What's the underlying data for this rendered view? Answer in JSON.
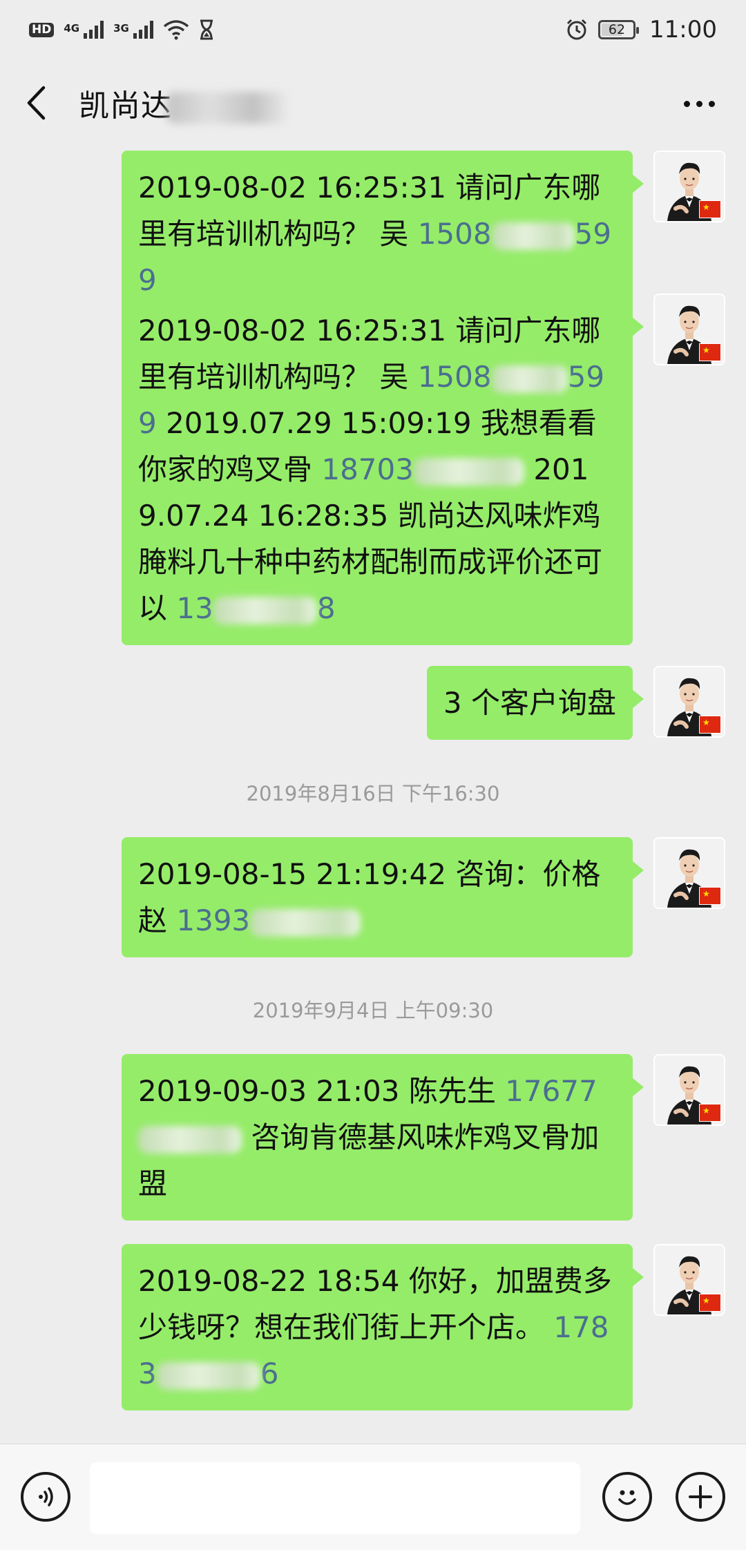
{
  "status_bar": {
    "hd": "HD",
    "net_1": "4G",
    "net_2": "3G",
    "battery": "62",
    "time": "11:00"
  },
  "header": {
    "title": "凯尚达"
  },
  "messages": [
    {
      "parts": [
        {
          "t": "text",
          "v": "2019-08-02 16:25:31  请问广东哪里有培训机构吗？    吴 "
        },
        {
          "t": "phone",
          "v": "1508"
        },
        {
          "t": "redact",
          "w": 120
        },
        {
          "t": "phone",
          "v": "599"
        }
      ]
    },
    {
      "parts": [
        {
          "t": "text",
          "v": "2019-08-02 16:25:31  请问广东哪里有培训机构吗？    吴 "
        },
        {
          "t": "phone",
          "v": "1508"
        },
        {
          "t": "redact",
          "w": 110
        },
        {
          "t": "phone",
          "v": "599"
        },
        {
          "t": "text",
          "v": " 2019.07.29 15:09:19 我想看看你家的鸡叉骨 "
        },
        {
          "t": "phone",
          "v": "18703"
        },
        {
          "t": "redact",
          "w": 160
        },
        {
          "t": "text",
          "v": " 2019.07.24 16:28:35 凯尚达风味炸鸡腌料几十种中药材配制而成评价还可以 "
        },
        {
          "t": "phone",
          "v": "13"
        },
        {
          "t": "redact",
          "w": 150
        },
        {
          "t": "phone",
          "v": "8"
        }
      ]
    },
    {
      "parts": [
        {
          "t": "text",
          "v": "3 个客户询盘"
        }
      ]
    },
    {
      "parts": [
        {
          "t": "text",
          "v": "2019-08-15 21:19:42 咨询：价格赵 "
        },
        {
          "t": "phone",
          "v": "1393"
        },
        {
          "t": "redact",
          "w": 160
        }
      ]
    },
    {
      "parts": [
        {
          "t": "text",
          "v": "2019-09-03 21:03  陈先生 "
        },
        {
          "t": "phone",
          "v": "17677"
        },
        {
          "t": "redact",
          "w": 150
        },
        {
          "t": "text",
          "v": " 咨询肯德基风味炸鸡叉骨加盟"
        }
      ]
    },
    {
      "parts": [
        {
          "t": "text",
          "v": "2019-08-22 18:54  你好，加盟费多少钱呀？想在我们街上开个店。 "
        },
        {
          "t": "phone",
          "v": "1783"
        },
        {
          "t": "redact",
          "w": 150
        },
        {
          "t": "phone",
          "v": "6"
        }
      ]
    }
  ],
  "timestamps": [
    "2019年8月16日 下午16:30",
    "2019年9月4日 上午09:30"
  ],
  "input": {
    "value": ""
  }
}
